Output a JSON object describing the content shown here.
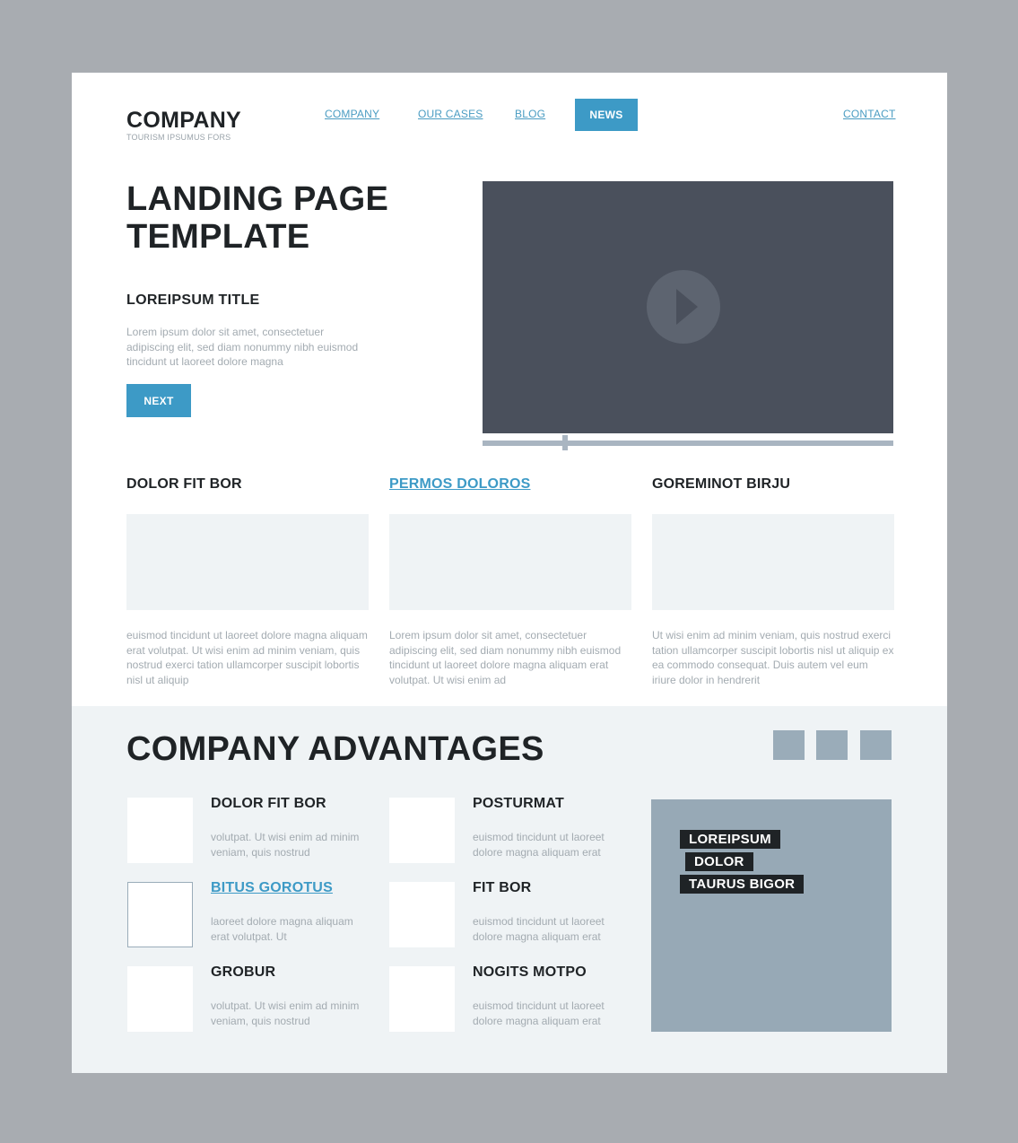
{
  "header": {
    "logo_name": "COMPANY",
    "logo_tagline": "TOURISM IPSUMUS FORS",
    "nav": [
      "COMPANY",
      "OUR CASES",
      "BLOG",
      "NEWS"
    ],
    "contact": "CONTACT",
    "active_nav": "NEWS"
  },
  "hero": {
    "title_line1": "LANDING PAGE",
    "title_line2": "TEMPLATE",
    "subtitle": "LOREIPSUM TITLE",
    "text": "Lorem ipsum dolor sit amet, consectetuer adipiscing elit, sed diam nonummy nibh euismod tincidunt ut laoreet dolore magna",
    "next_label": "NEXT",
    "video_progress": 0.2
  },
  "columns": [
    {
      "title": "DOLOR FIT BOR",
      "text": "euismod tincidunt ut laoreet dolore magna aliquam erat volutpat. Ut wisi enim ad minim veniam, quis nostrud exerci tation ullamcorper suscipit lobortis nisl ut aliquip"
    },
    {
      "title": "PERMOS DOLOROS",
      "text": "Lorem ipsum dolor sit amet, consectetuer adipiscing elit, sed diam nonummy nibh euismod tincidunt ut laoreet dolore magna aliquam erat volutpat. Ut wisi enim ad"
    },
    {
      "title": "GOREMINOT BIRJU",
      "text": "Ut wisi enim ad minim veniam, quis nostrud exerci tation ullamcorper suscipit lobortis nisl ut aliquip ex ea commodo consequat. Duis autem vel eum iriure dolor in hendrerit"
    }
  ],
  "advantages": {
    "title": "COMPANY ADVANTAGES",
    "items": [
      {
        "title": "DOLOR FIT BOR",
        "text": " volutpat. Ut wisi enim ad minim veniam, quis nostrud"
      },
      {
        "title": "BITUS GOROTUS",
        "text": "laoreet dolore magna aliquam erat volutpat. Ut"
      },
      {
        "title": "GROBUR",
        "text": "volutpat. Ut wisi enim ad minim veniam, quis nostrud"
      },
      {
        "title": "POSTURMAT",
        "text": "euismod tincidunt ut laoreet dolore magna aliquam erat"
      },
      {
        "title": "FIT BOR",
        "text": "euismod tincidunt ut laoreet dolore magna aliquam erat"
      },
      {
        "title": "NOGITS MOTPO",
        "text": "euismod tincidunt ut laoreet dolore magna aliquam erat"
      }
    ],
    "feature_tags": [
      "LOREIPSUM",
      "DOLOR",
      "TAURUS BIGOR"
    ]
  },
  "colors": {
    "accent": "#3d9ac6",
    "dark": "#1f2326",
    "video": "#4a505c",
    "panel": "#97a9b6",
    "section_bg": "#eff3f5"
  }
}
